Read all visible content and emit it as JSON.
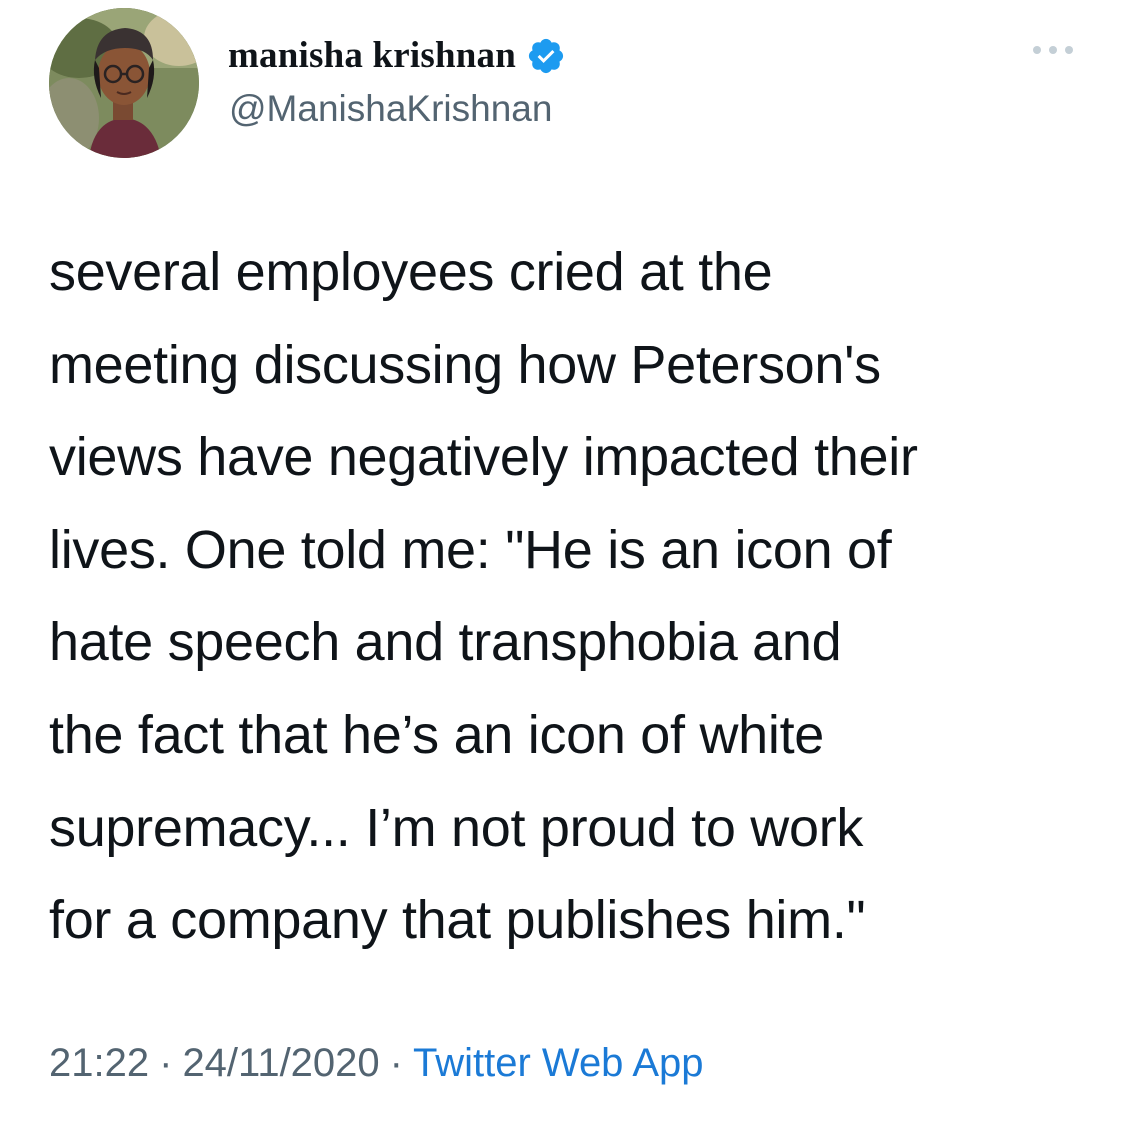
{
  "author": {
    "display_name": "manisha krishnan",
    "handle": "@ManishaKrishnan",
    "verified": true,
    "avatar_icon": "profile-photo"
  },
  "menu": {
    "icon": "more-options-icon"
  },
  "tweet": {
    "lines": [
      "several employees cried at the",
      "meeting discussing how Peterson's",
      "views have negatively impacted their",
      "lives. One told me: \"He is an icon of",
      "hate speech and transphobia and",
      "the fact that he’s an icon of white",
      "supremacy... I’m not proud to work",
      "for a company that publishes him.\""
    ]
  },
  "meta": {
    "time": "21:22",
    "separator": "·",
    "date": "24/11/2020",
    "source": "Twitter Web App"
  },
  "colors": {
    "text": "#0f1419",
    "secondary": "#536471",
    "link": "#1b7ad6",
    "verified": "#1d9bf0"
  }
}
